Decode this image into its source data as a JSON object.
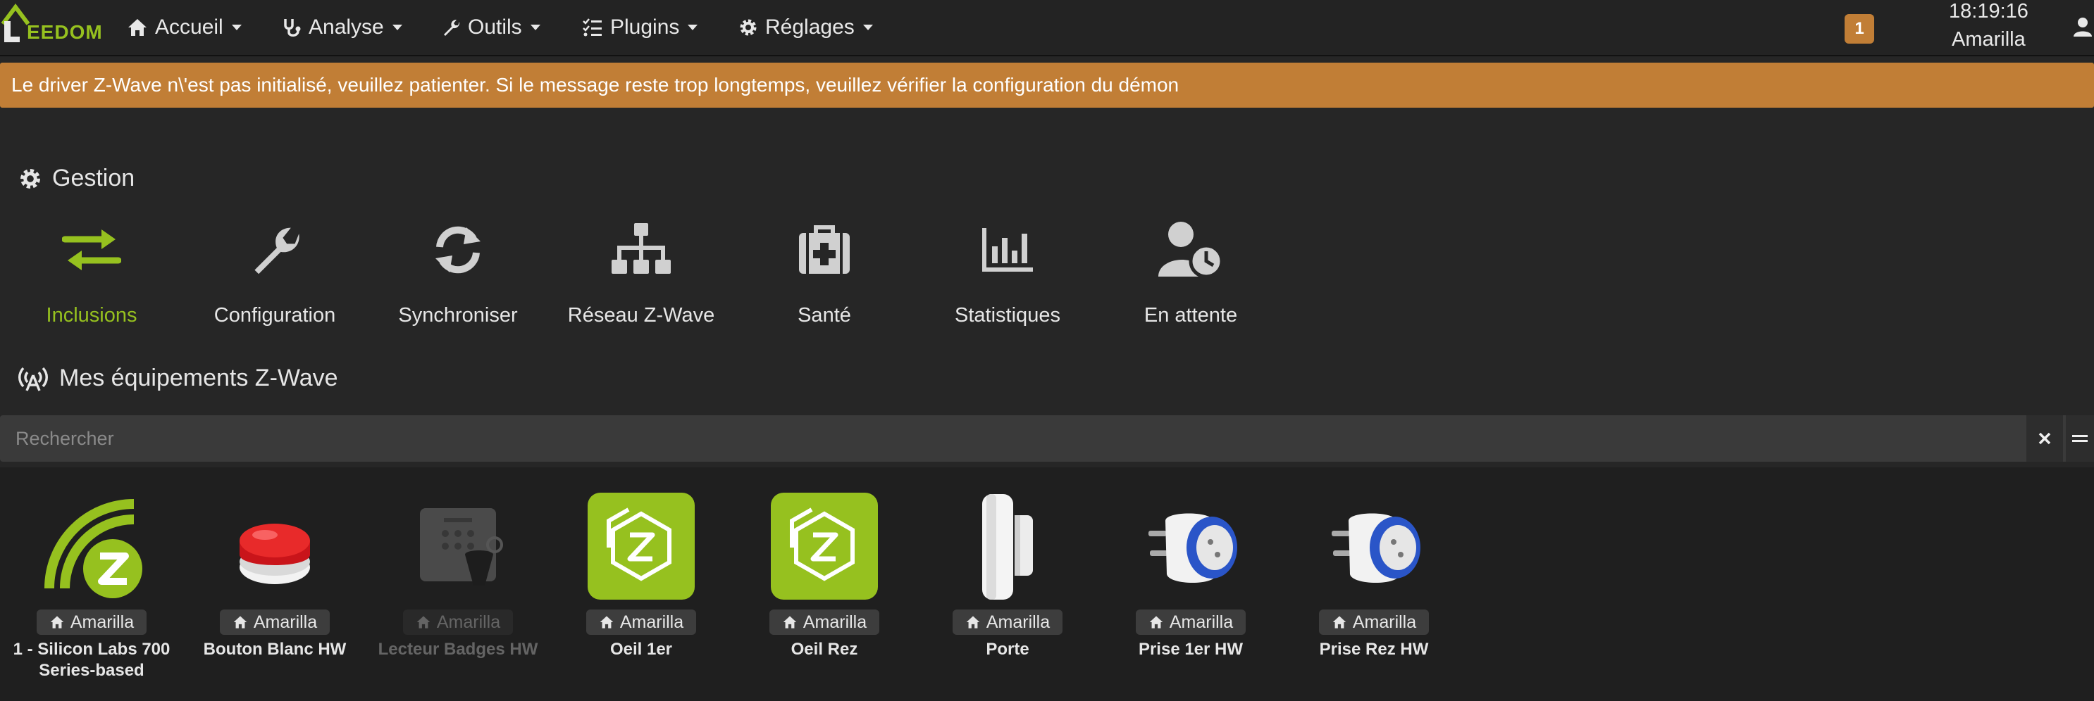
{
  "navbar": {
    "logo_text": "EEDOM",
    "menu": [
      {
        "label": "Accueil"
      },
      {
        "label": "Analyse"
      },
      {
        "label": "Outils"
      },
      {
        "label": "Plugins"
      },
      {
        "label": "Réglages"
      }
    ],
    "notif_count": "1",
    "time": "18:19:16",
    "user": "Amarilla"
  },
  "alert": {
    "text": "Le driver Z-Wave n\\'est pas initialisé, veuillez patienter. Si le message reste trop longtemps, veuillez vérifier la configuration du démon",
    "color": "#c17e36"
  },
  "gestion": {
    "title": "Gestion",
    "items": [
      {
        "label": "Inclusions",
        "icon": "exchange-arrows-icon",
        "active": true
      },
      {
        "label": "Configuration",
        "icon": "wrench-icon"
      },
      {
        "label": "Synchroniser",
        "icon": "sync-icon"
      },
      {
        "label": "Réseau Z-Wave",
        "icon": "network-icon"
      },
      {
        "label": "Santé",
        "icon": "medkit-icon"
      },
      {
        "label": "Statistiques",
        "icon": "bar-chart-icon"
      },
      {
        "label": "En attente",
        "icon": "user-clock-icon"
      }
    ]
  },
  "equipments": {
    "title": "Mes équipements Z-Wave",
    "search_placeholder": "Rechercher",
    "items": [
      {
        "name": "1 - Silicon Labs 700 Series-based",
        "object": "Amarilla",
        "icon": "zwave-controller-icon"
      },
      {
        "name": "Bouton Blanc HW",
        "object": "Amarilla",
        "icon": "red-button-icon"
      },
      {
        "name": "Lecteur Badges HW",
        "object": "Amarilla",
        "icon": "badge-reader-icon",
        "disabled": true
      },
      {
        "name": "Oeil 1er",
        "object": "Amarilla",
        "icon": "zwave-logo-icon"
      },
      {
        "name": "Oeil Rez",
        "object": "Amarilla",
        "icon": "zwave-logo-icon"
      },
      {
        "name": "Porte",
        "object": "Amarilla",
        "icon": "door-sensor-icon"
      },
      {
        "name": "Prise 1er HW",
        "object": "Amarilla",
        "icon": "smart-plug-icon"
      },
      {
        "name": "Prise Rez HW",
        "object": "Amarilla",
        "icon": "smart-plug-icon"
      }
    ]
  },
  "colors": {
    "accent": "#96c11f",
    "warning": "#c17e36",
    "background": "#262626"
  }
}
